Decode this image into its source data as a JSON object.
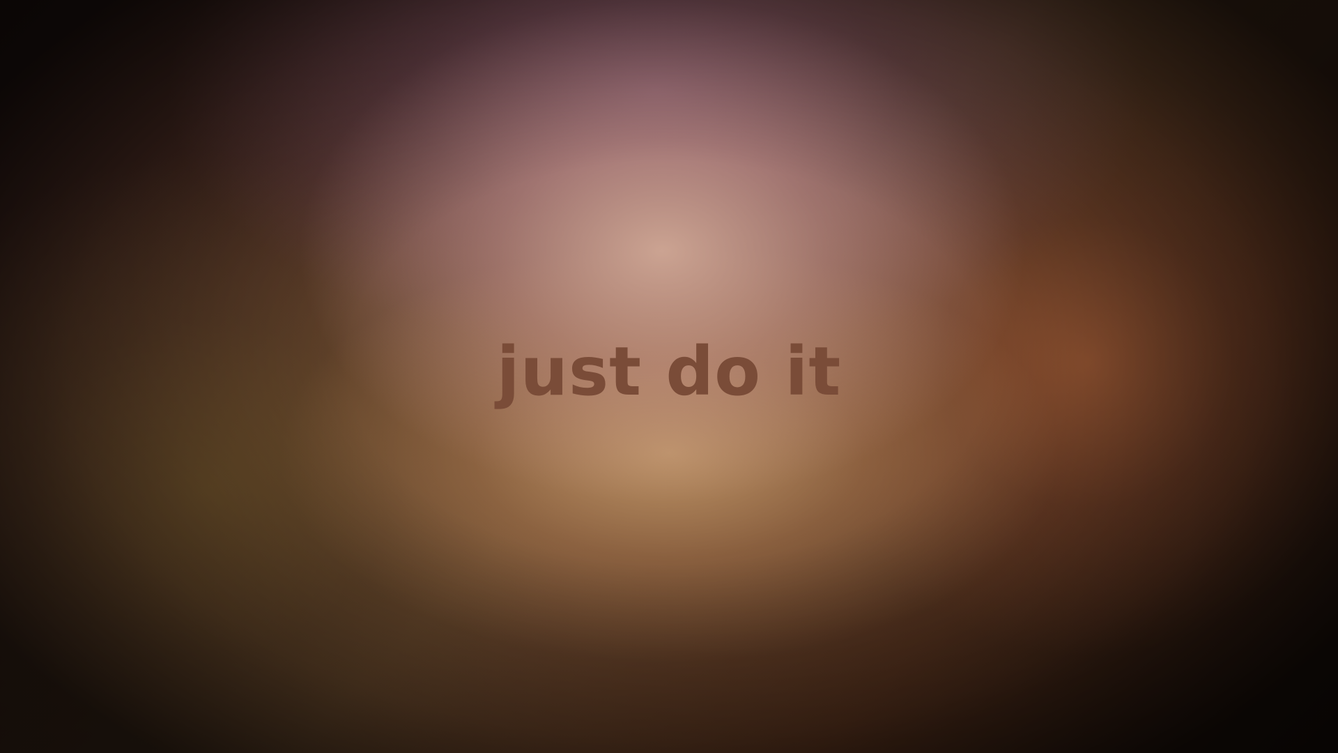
{
  "wallpaper": {
    "tagline": "just do it",
    "colors": {
      "text": "#7a4c38",
      "center_glow": "#d0a896",
      "top_tint": "#96647d",
      "warm_right": "#965532",
      "olive_left": "#6e522a",
      "corners": "#1e120c"
    }
  }
}
